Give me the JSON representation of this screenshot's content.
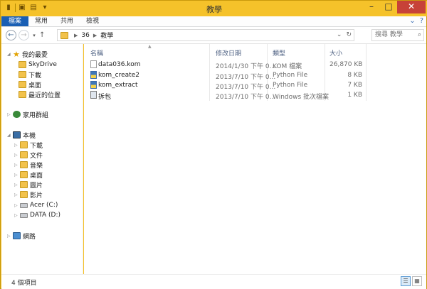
{
  "window": {
    "title": "教學"
  },
  "quick_access": {
    "icons": [
      "folder-icon",
      "properties-icon",
      "new-folder-icon",
      "customize-dropdown-icon"
    ]
  },
  "ribbon": {
    "tabs": [
      "檔案",
      "常用",
      "共用",
      "檢視"
    ]
  },
  "address": {
    "segments": [
      "36",
      "教學"
    ]
  },
  "search": {
    "placeholder": "搜尋 教學"
  },
  "sidebar": {
    "favorites_label": "我的最愛",
    "favorites": [
      "SkyDrive",
      "下載",
      "桌面",
      "最近的位置"
    ],
    "homegroup_label": "家用群組",
    "pc_label": "本機",
    "pc_items": [
      "下載",
      "文件",
      "音樂",
      "桌面",
      "圖片",
      "影片",
      "Acer (C:)",
      "DATA (D:)"
    ],
    "network_label": "網路"
  },
  "columns": {
    "name": "名稱",
    "date": "修改日期",
    "type": "類型",
    "size": "大小"
  },
  "files": [
    {
      "name": "data036.kom",
      "date": "2014/1/30 下午 0...",
      "type": "KOM 檔案",
      "size": "26,870 KB",
      "icon": "file-icon"
    },
    {
      "name": "kom_create2",
      "date": "2013/7/10 下午 0...",
      "type": "Python File",
      "size": "8 KB",
      "icon": "python-file-icon"
    },
    {
      "name": "kom_extract",
      "date": "2013/7/10 下午 0...",
      "type": "Python File",
      "size": "7 KB",
      "icon": "python-file-icon"
    },
    {
      "name": "拆包",
      "date": "2013/7/10 下午 0...",
      "type": "Windows 批次檔案",
      "size": "1 KB",
      "icon": "batch-file-icon"
    }
  ],
  "status": {
    "count": "4 個項目"
  }
}
